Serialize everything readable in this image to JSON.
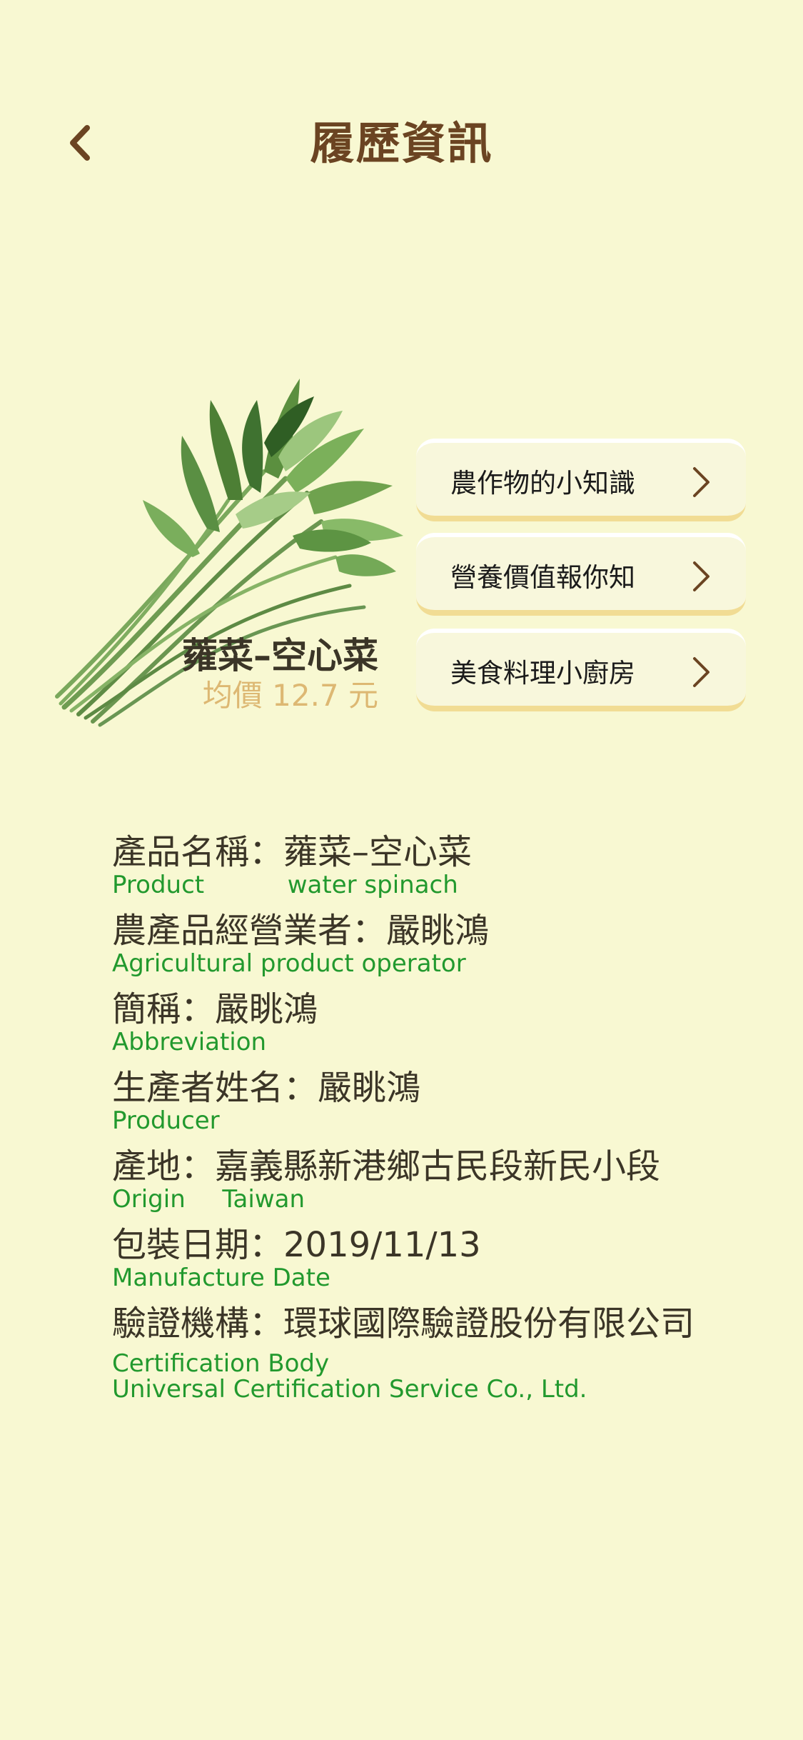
{
  "header": {
    "title": "履歷資訊",
    "back_icon": "chevron-left-icon"
  },
  "colors": {
    "background": "#f8f8d2",
    "title": "#6b4422",
    "english_text": "#22992e",
    "price": "#ddb873",
    "button_underline": "#f1dc94"
  },
  "product_card": {
    "name": "蕹菜–空心菜",
    "price": "均價 12.7 元",
    "image_icon": "water-spinach-illustration"
  },
  "menu": [
    {
      "label": "農作物的小知識",
      "icon": "chevron-right-icon"
    },
    {
      "label": "營養價值報你知",
      "icon": "chevron-right-icon"
    },
    {
      "label": "美食料理小廚房",
      "icon": "chevron-right-icon"
    }
  ],
  "info": {
    "product": {
      "zh": "產品名稱：蕹菜–空心菜",
      "en_label": "Product",
      "en_value": "water spinach"
    },
    "operator": {
      "zh": "農產品經營業者：嚴眺鴻",
      "en_label": "Agricultural product operator"
    },
    "abbreviation": {
      "zh": "簡稱：嚴眺鴻",
      "en_label": "Abbreviation"
    },
    "producer": {
      "zh": "生產者姓名：嚴眺鴻",
      "en_label": "Producer"
    },
    "origin": {
      "zh": "產地：嘉義縣新港鄉古民段新民小段",
      "en_label": "Origin",
      "en_value": "Taiwan"
    },
    "manufacture_date": {
      "zh": "包裝日期：2019/11/13",
      "en_label": "Manufacture Date"
    },
    "certification": {
      "zh": "驗證機構：環球國際驗證股份有限公司",
      "en_label": "Certification Body",
      "en_value": "Universal Certification Service Co., Ltd."
    }
  }
}
